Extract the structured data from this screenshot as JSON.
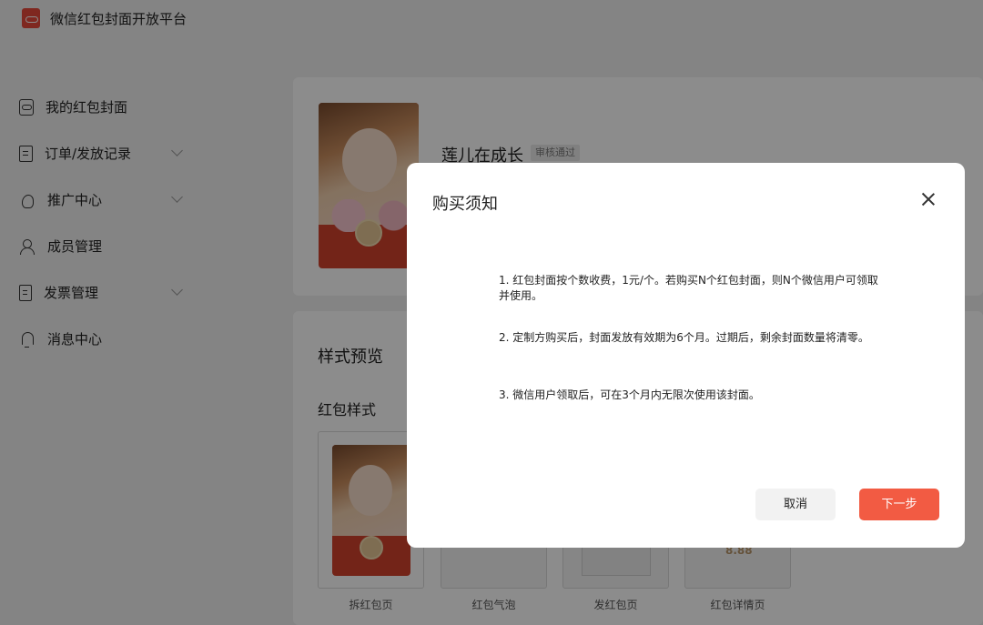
{
  "app": {
    "title": "微信红包封面开放平台"
  },
  "sidebar": {
    "items": [
      {
        "label": "我的红包封面",
        "icon": "cover-icon",
        "has_submenu": false
      },
      {
        "label": "订单/发放记录",
        "icon": "order-icon",
        "has_submenu": true
      },
      {
        "label": "推广中心",
        "icon": "flame-icon",
        "has_submenu": true
      },
      {
        "label": "成员管理",
        "icon": "member-icon",
        "has_submenu": false
      },
      {
        "label": "发票管理",
        "icon": "invoice-icon",
        "has_submenu": true
      },
      {
        "label": "消息中心",
        "icon": "bell-icon",
        "has_submenu": false
      }
    ]
  },
  "cover": {
    "name": "莲儿在成长",
    "status": "审核通过"
  },
  "style_preview": {
    "title": "样式预览",
    "subtitle": "红包样式",
    "previews": [
      {
        "label": "拆红包页"
      },
      {
        "label": "红包气泡"
      },
      {
        "label": "发红包页"
      },
      {
        "label": "红包详情页",
        "amount": "8.88"
      }
    ]
  },
  "modal": {
    "title": "购买须知",
    "notices": [
      "1. 红包封面按个数收费，1元/个。若购买N个红包封面，则N个微信用户可领取并使用。",
      "2. 定制方购买后，封面发放有效期为6个月。过期后，剩余封面数量将清零。",
      "3. 微信用户领取后，可在3个月内无限次使用该封面。"
    ],
    "cancel_label": "取消",
    "next_label": "下一步"
  },
  "colors": {
    "accent": "#f25b43",
    "brand_red": "#e8493b",
    "overlay": "rgba(0,0,0,0.45)"
  }
}
